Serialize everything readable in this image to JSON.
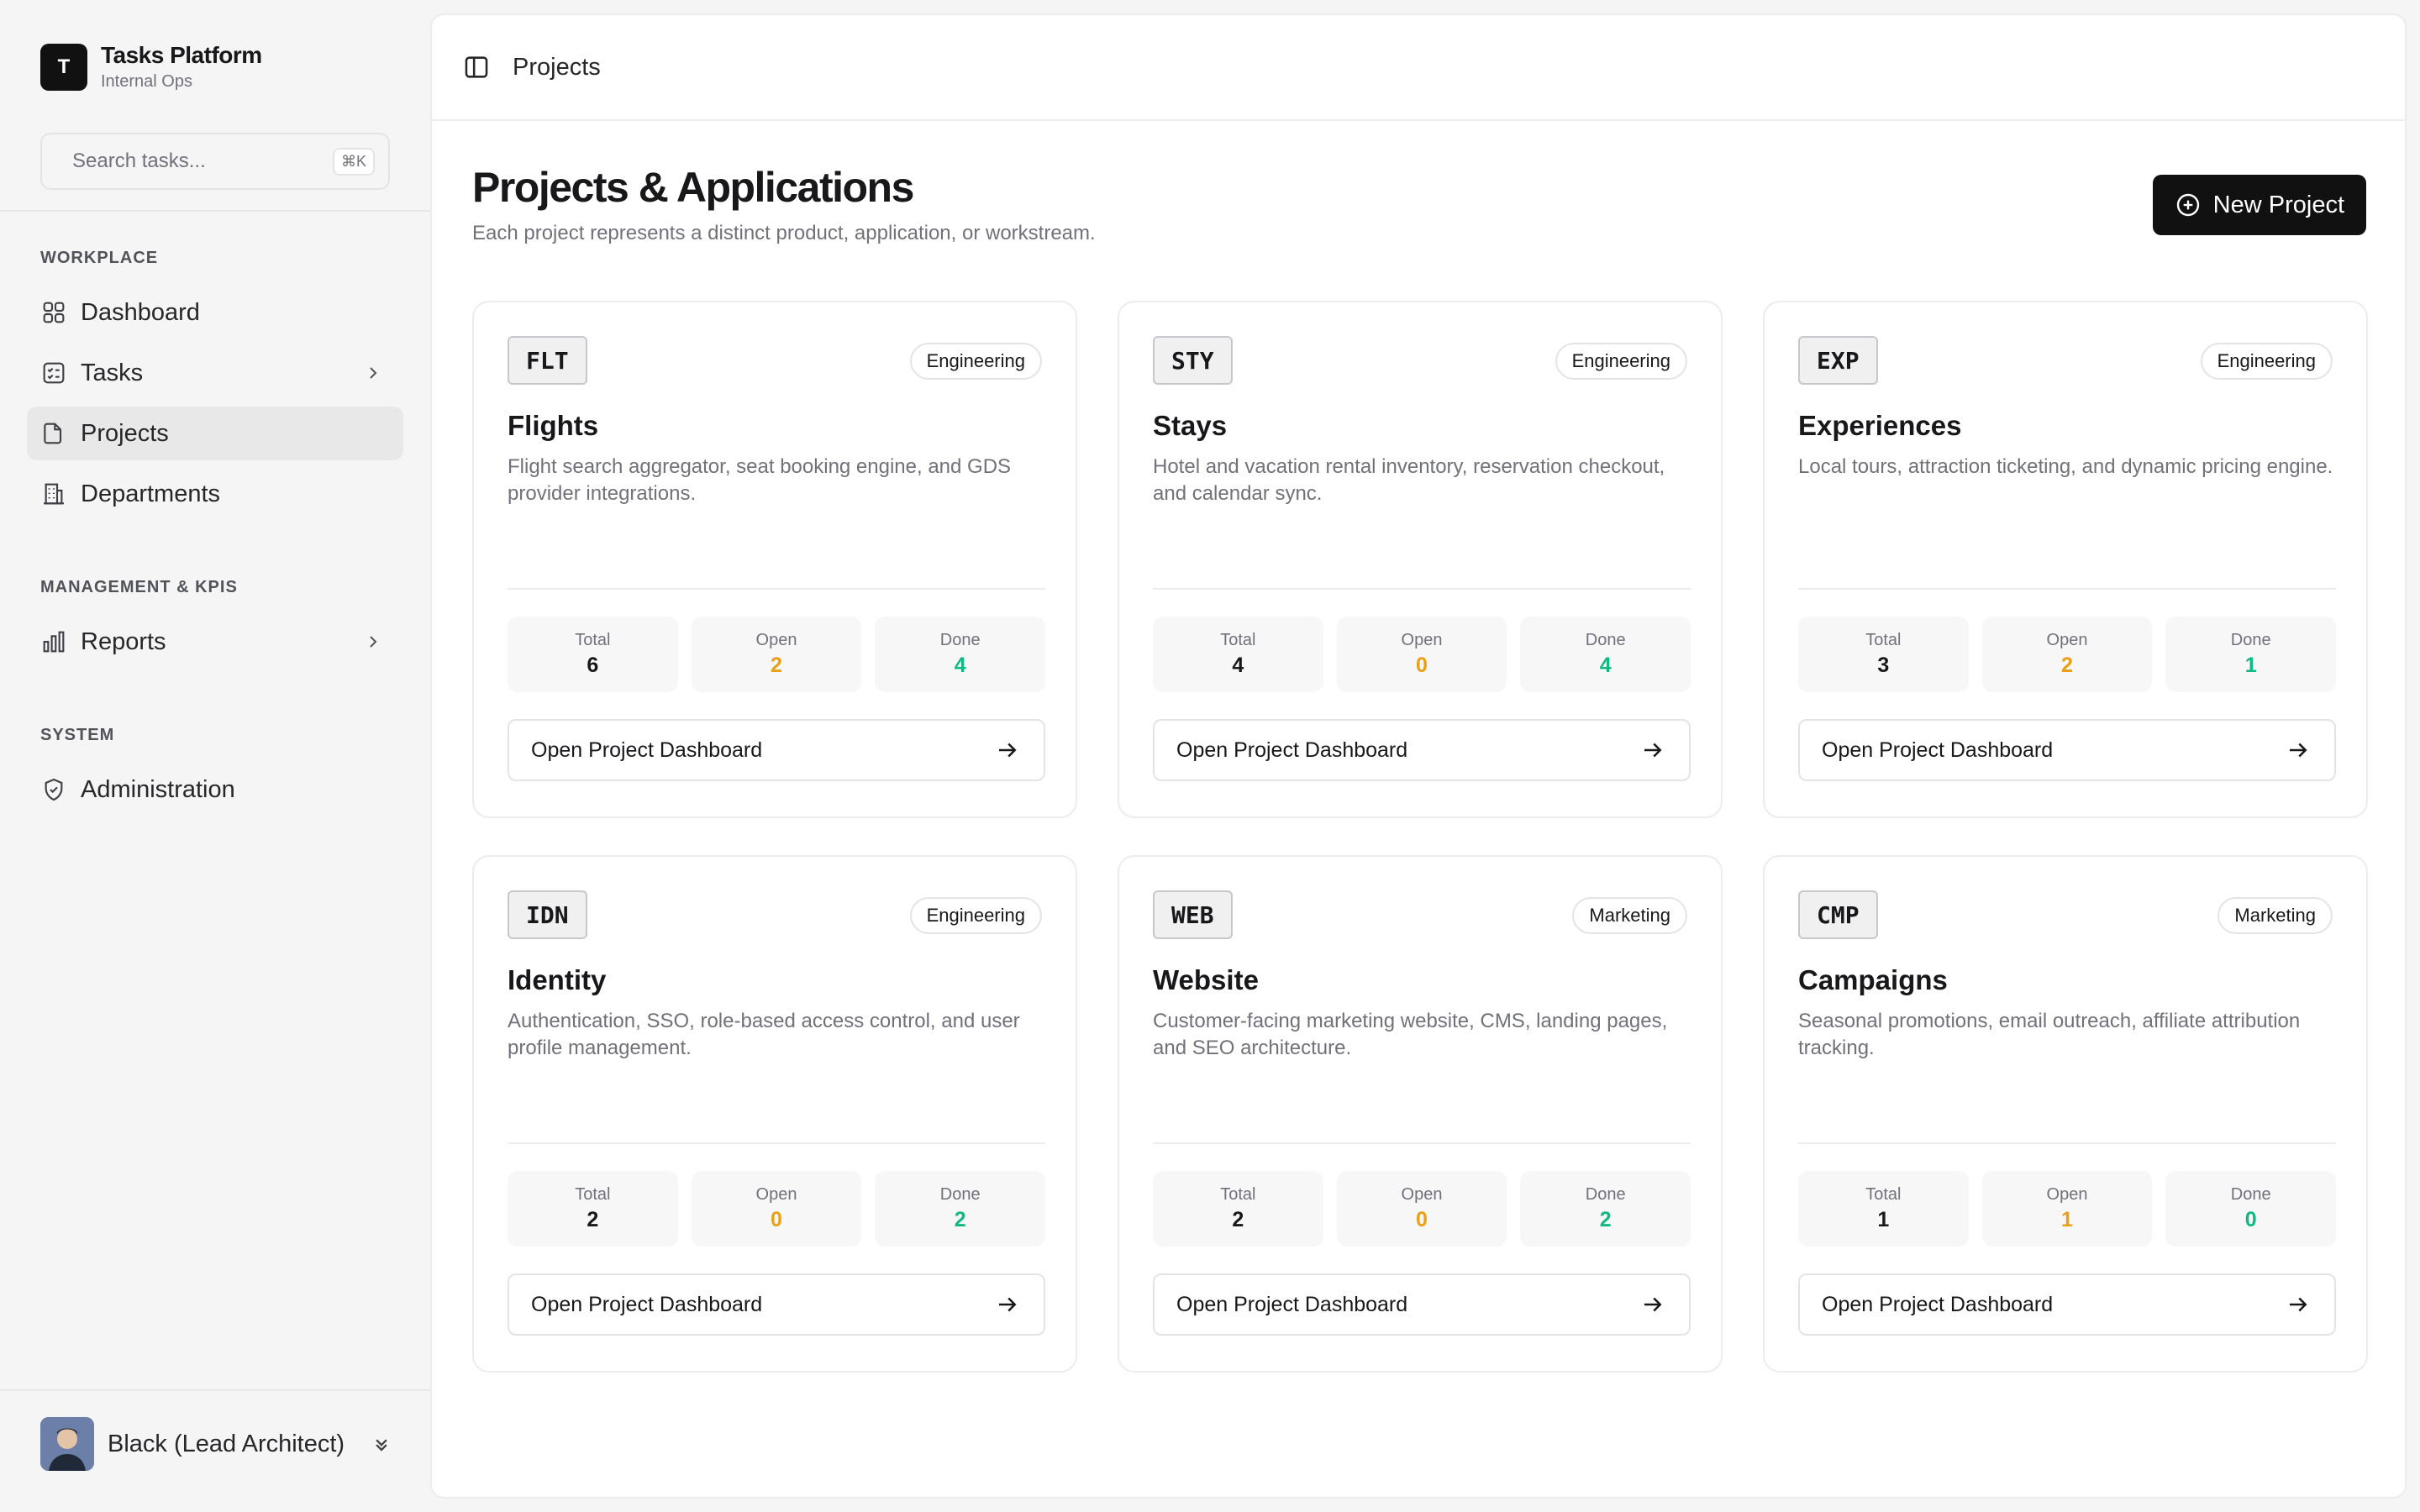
{
  "brand": {
    "logo_letter": "T",
    "title": "Tasks Platform",
    "subtitle": "Internal Ops"
  },
  "search": {
    "placeholder": "Search tasks...",
    "shortcut": "⌘K"
  },
  "sidebar": {
    "sections": [
      {
        "label": "WORKPLACE"
      },
      {
        "label": "MANAGEMENT & KPIS"
      },
      {
        "label": "SYSTEM"
      }
    ],
    "items": [
      {
        "label": "Dashboard",
        "icon": "grid-icon"
      },
      {
        "label": "Tasks",
        "icon": "checklist-icon"
      },
      {
        "label": "Projects",
        "icon": "folder-icon",
        "active": true
      },
      {
        "label": "Departments",
        "icon": "building-icon"
      },
      {
        "label": "Reports",
        "icon": "bar-chart-icon"
      },
      {
        "label": "Administration",
        "icon": "shield-check-icon"
      }
    ]
  },
  "user": {
    "name": "Black (Lead Architect)"
  },
  "header": {
    "breadcrumb": "Projects"
  },
  "page": {
    "title": "Projects & Applications",
    "subtitle": "Each project represents a distinct product, application, or workstream.",
    "new_button": "New Project"
  },
  "stat_labels": {
    "total": "Total",
    "open": "Open",
    "done": "Done"
  },
  "card_button_label": "Open Project Dashboard",
  "projects": [
    {
      "code": "FLT",
      "tag": "Engineering",
      "name": "Flights",
      "description": "Flight search aggregator, seat booking engine, and GDS provider integrations.",
      "total": "6",
      "open": "2",
      "done": "4"
    },
    {
      "code": "STY",
      "tag": "Engineering",
      "name": "Stays",
      "description": "Hotel and vacation rental inventory, reservation checkout, and calendar sync.",
      "total": "4",
      "open": "0",
      "done": "4"
    },
    {
      "code": "EXP",
      "tag": "Engineering",
      "name": "Experiences",
      "description": "Local tours, attraction ticketing, and dynamic pricing engine.",
      "total": "3",
      "open": "2",
      "done": "1"
    },
    {
      "code": "IDN",
      "tag": "Engineering",
      "name": "Identity",
      "description": "Authentication, SSO, role-based access control, and user profile management.",
      "total": "2",
      "open": "0",
      "done": "2"
    },
    {
      "code": "WEB",
      "tag": "Marketing",
      "name": "Website",
      "description": "Customer-facing marketing website, CMS, landing pages, and SEO architecture.",
      "total": "2",
      "open": "0",
      "done": "2"
    },
    {
      "code": "CMP",
      "tag": "Marketing",
      "name": "Campaigns",
      "description": "Seasonal promotions, email outreach, affiliate attribution tracking.",
      "total": "1",
      "open": "1",
      "done": "0"
    }
  ],
  "colors": {
    "open": "#eaa012",
    "done": "#10b981",
    "primary": "#111111"
  }
}
